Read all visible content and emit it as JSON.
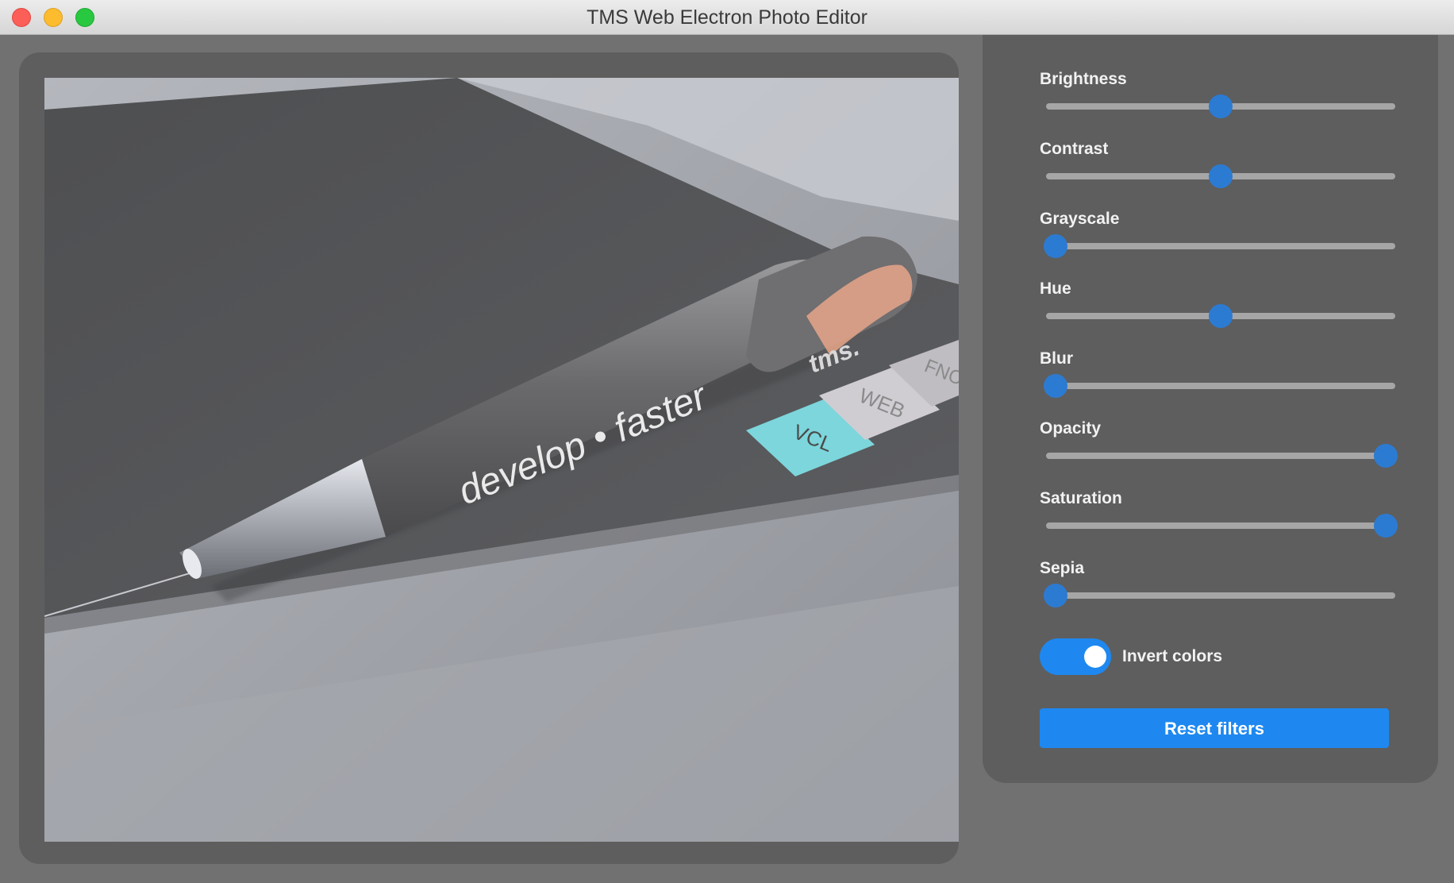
{
  "window": {
    "title": "TMS Web Electron Photo Editor"
  },
  "photo": {
    "description_icon": "pen-photo",
    "pen_text": "develop • faster",
    "clip_text": "tms.",
    "keys": [
      "VCL",
      "WEB",
      "FNC"
    ]
  },
  "filters": [
    {
      "label": "Brightness",
      "value": 0.5
    },
    {
      "label": "Contrast",
      "value": 0.5
    },
    {
      "label": "Grayscale",
      "value": 0.0
    },
    {
      "label": "Hue",
      "value": 0.5
    },
    {
      "label": "Blur",
      "value": 0.0
    },
    {
      "label": "Opacity",
      "value": 1.0
    },
    {
      "label": "Saturation",
      "value": 1.0
    },
    {
      "label": "Sepia",
      "value": 0.0
    }
  ],
  "invert": {
    "label": "Invert colors",
    "enabled": true
  },
  "reset_label": "Reset filters",
  "colors": {
    "accent": "#1e88f0",
    "slider_thumb": "#2c7bd2",
    "panel": "#5e5e5e",
    "background": "#717171"
  }
}
